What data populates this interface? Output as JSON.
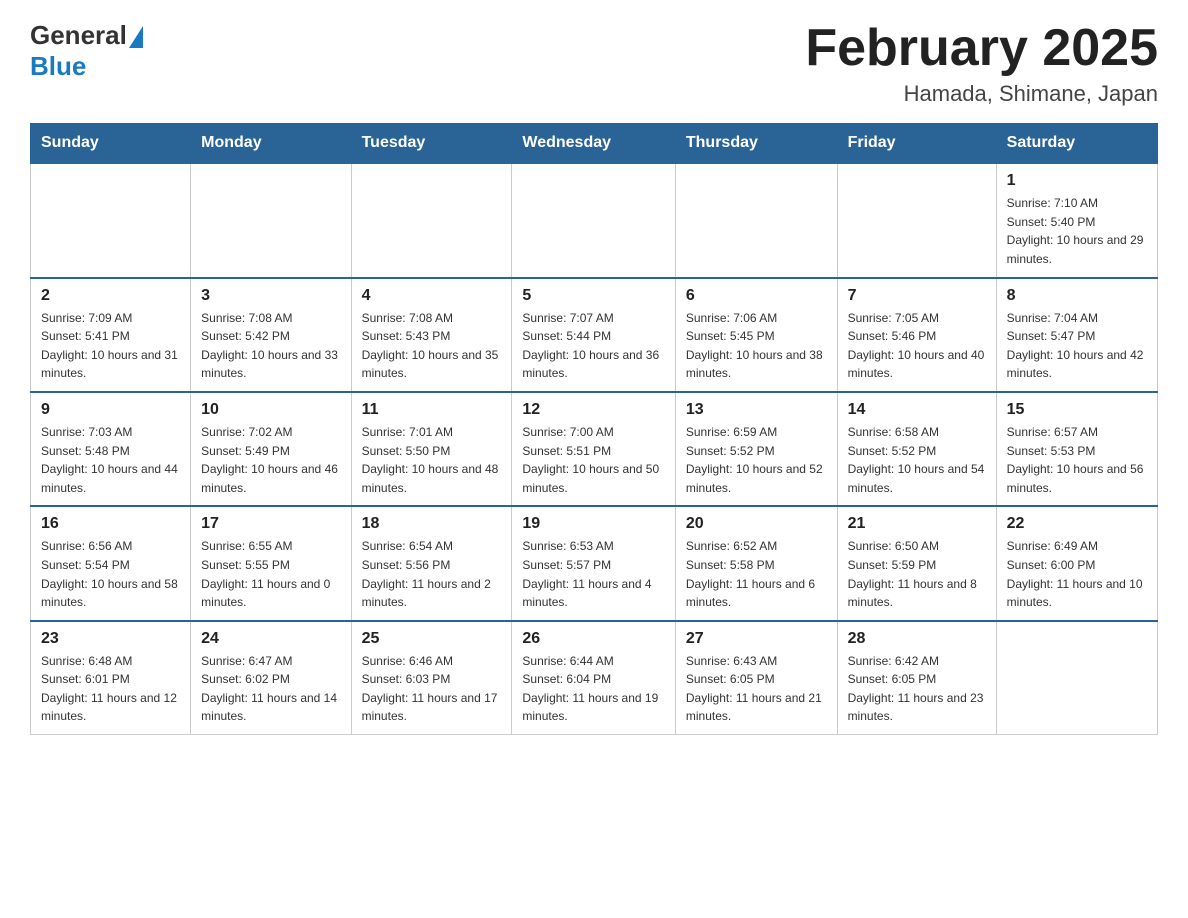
{
  "logo": {
    "general": "General",
    "blue": "Blue"
  },
  "header": {
    "title": "February 2025",
    "location": "Hamada, Shimane, Japan"
  },
  "weekdays": [
    "Sunday",
    "Monday",
    "Tuesday",
    "Wednesday",
    "Thursday",
    "Friday",
    "Saturday"
  ],
  "weeks": [
    [
      {
        "day": null,
        "info": null
      },
      {
        "day": null,
        "info": null
      },
      {
        "day": null,
        "info": null
      },
      {
        "day": null,
        "info": null
      },
      {
        "day": null,
        "info": null
      },
      {
        "day": null,
        "info": null
      },
      {
        "day": "1",
        "info": "Sunrise: 7:10 AM\nSunset: 5:40 PM\nDaylight: 10 hours and 29 minutes."
      }
    ],
    [
      {
        "day": "2",
        "info": "Sunrise: 7:09 AM\nSunset: 5:41 PM\nDaylight: 10 hours and 31 minutes."
      },
      {
        "day": "3",
        "info": "Sunrise: 7:08 AM\nSunset: 5:42 PM\nDaylight: 10 hours and 33 minutes."
      },
      {
        "day": "4",
        "info": "Sunrise: 7:08 AM\nSunset: 5:43 PM\nDaylight: 10 hours and 35 minutes."
      },
      {
        "day": "5",
        "info": "Sunrise: 7:07 AM\nSunset: 5:44 PM\nDaylight: 10 hours and 36 minutes."
      },
      {
        "day": "6",
        "info": "Sunrise: 7:06 AM\nSunset: 5:45 PM\nDaylight: 10 hours and 38 minutes."
      },
      {
        "day": "7",
        "info": "Sunrise: 7:05 AM\nSunset: 5:46 PM\nDaylight: 10 hours and 40 minutes."
      },
      {
        "day": "8",
        "info": "Sunrise: 7:04 AM\nSunset: 5:47 PM\nDaylight: 10 hours and 42 minutes."
      }
    ],
    [
      {
        "day": "9",
        "info": "Sunrise: 7:03 AM\nSunset: 5:48 PM\nDaylight: 10 hours and 44 minutes."
      },
      {
        "day": "10",
        "info": "Sunrise: 7:02 AM\nSunset: 5:49 PM\nDaylight: 10 hours and 46 minutes."
      },
      {
        "day": "11",
        "info": "Sunrise: 7:01 AM\nSunset: 5:50 PM\nDaylight: 10 hours and 48 minutes."
      },
      {
        "day": "12",
        "info": "Sunrise: 7:00 AM\nSunset: 5:51 PM\nDaylight: 10 hours and 50 minutes."
      },
      {
        "day": "13",
        "info": "Sunrise: 6:59 AM\nSunset: 5:52 PM\nDaylight: 10 hours and 52 minutes."
      },
      {
        "day": "14",
        "info": "Sunrise: 6:58 AM\nSunset: 5:52 PM\nDaylight: 10 hours and 54 minutes."
      },
      {
        "day": "15",
        "info": "Sunrise: 6:57 AM\nSunset: 5:53 PM\nDaylight: 10 hours and 56 minutes."
      }
    ],
    [
      {
        "day": "16",
        "info": "Sunrise: 6:56 AM\nSunset: 5:54 PM\nDaylight: 10 hours and 58 minutes."
      },
      {
        "day": "17",
        "info": "Sunrise: 6:55 AM\nSunset: 5:55 PM\nDaylight: 11 hours and 0 minutes."
      },
      {
        "day": "18",
        "info": "Sunrise: 6:54 AM\nSunset: 5:56 PM\nDaylight: 11 hours and 2 minutes."
      },
      {
        "day": "19",
        "info": "Sunrise: 6:53 AM\nSunset: 5:57 PM\nDaylight: 11 hours and 4 minutes."
      },
      {
        "day": "20",
        "info": "Sunrise: 6:52 AM\nSunset: 5:58 PM\nDaylight: 11 hours and 6 minutes."
      },
      {
        "day": "21",
        "info": "Sunrise: 6:50 AM\nSunset: 5:59 PM\nDaylight: 11 hours and 8 minutes."
      },
      {
        "day": "22",
        "info": "Sunrise: 6:49 AM\nSunset: 6:00 PM\nDaylight: 11 hours and 10 minutes."
      }
    ],
    [
      {
        "day": "23",
        "info": "Sunrise: 6:48 AM\nSunset: 6:01 PM\nDaylight: 11 hours and 12 minutes."
      },
      {
        "day": "24",
        "info": "Sunrise: 6:47 AM\nSunset: 6:02 PM\nDaylight: 11 hours and 14 minutes."
      },
      {
        "day": "25",
        "info": "Sunrise: 6:46 AM\nSunset: 6:03 PM\nDaylight: 11 hours and 17 minutes."
      },
      {
        "day": "26",
        "info": "Sunrise: 6:44 AM\nSunset: 6:04 PM\nDaylight: 11 hours and 19 minutes."
      },
      {
        "day": "27",
        "info": "Sunrise: 6:43 AM\nSunset: 6:05 PM\nDaylight: 11 hours and 21 minutes."
      },
      {
        "day": "28",
        "info": "Sunrise: 6:42 AM\nSunset: 6:05 PM\nDaylight: 11 hours and 23 minutes."
      },
      {
        "day": null,
        "info": null
      }
    ]
  ]
}
